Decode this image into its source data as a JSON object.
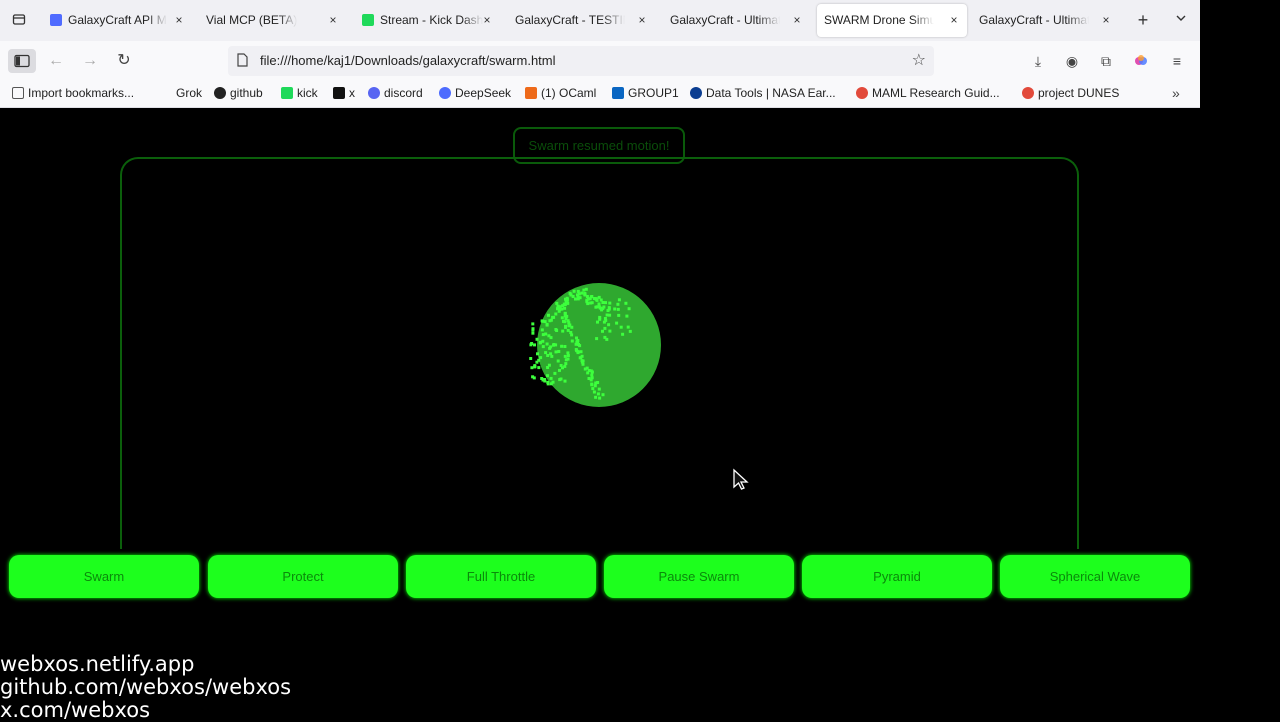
{
  "browser": {
    "tabs": [
      {
        "title": "GalaxyCraft API M",
        "favicon_color": "#4f6bff"
      },
      {
        "title": "Vial MCP (BETA)",
        "favicon_color": ""
      },
      {
        "title": "Stream - Kick Dash",
        "favicon_color": "#1fd95a"
      },
      {
        "title": "GalaxyCraft - TESTING",
        "favicon_color": ""
      },
      {
        "title": "GalaxyCraft - Ultimate",
        "favicon_color": ""
      },
      {
        "title": "SWARM Drone Simula",
        "favicon_color": ""
      },
      {
        "title": "GalaxyCraft - Ultimate",
        "favicon_color": ""
      }
    ],
    "close_glyph": "×",
    "new_tab_glyph": "+",
    "url": "file:///home/kaj1/Downloads/galaxycraft/swarm.html",
    "bookmarks": [
      {
        "label": "Import bookmarks...",
        "icon": "import-icon"
      },
      {
        "label": "Grok",
        "icon": ""
      },
      {
        "label": "github",
        "icon": "github-icon"
      },
      {
        "label": "kick",
        "icon": "kick-icon"
      },
      {
        "label": "x",
        "icon": "x-icon"
      },
      {
        "label": "discord",
        "icon": "discord-icon"
      },
      {
        "label": "DeepSeek",
        "icon": "deepseek-icon"
      },
      {
        "label": "(1) OCaml",
        "icon": "ocaml-icon"
      },
      {
        "label": "GROUP1",
        "icon": "linkedin-icon"
      },
      {
        "label": "Data Tools | NASA Ear...",
        "icon": "nasa-icon"
      },
      {
        "label": "MAML Research Guid...",
        "icon": "maml-icon"
      },
      {
        "label": "project DUNES",
        "icon": "dunes-icon"
      }
    ]
  },
  "page": {
    "notice": "Swarm resumed motion!",
    "buttons": [
      "Swarm",
      "Protect",
      "Full Throttle",
      "Pause Swarm",
      "Pyramid",
      "Spherical Wave"
    ],
    "footer": [
      "webxos.netlify.app",
      "github.com/webxos/webxos",
      "x.com/webxos"
    ],
    "colors": {
      "accent": "#1dff1d",
      "border": "#0b5f0b",
      "sphere": "#2fa82f"
    }
  }
}
